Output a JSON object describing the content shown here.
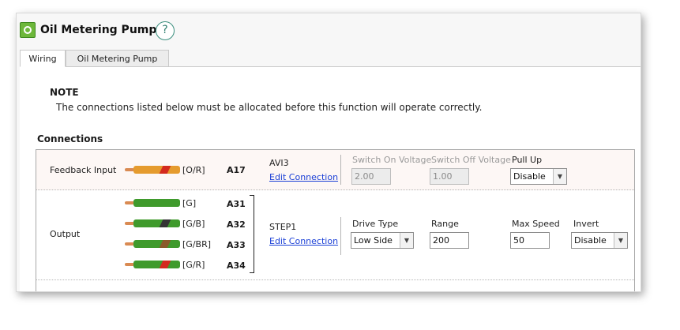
{
  "window": {
    "title": "Oil Metering Pump",
    "app_icon": "green-pump-icon",
    "help_icon": "question-mark-icon"
  },
  "tabs": [
    {
      "label": "Wiring",
      "active": true
    },
    {
      "label": "Oil Metering Pump",
      "active": false
    }
  ],
  "note": {
    "heading": "NOTE",
    "text": "The connections listed below must be allocated before this function will operate correctly."
  },
  "connections": {
    "heading": "Connections",
    "feedback": {
      "label": "Feedback Input",
      "wire": {
        "color_code": "[O/R]",
        "pin": "A17",
        "base_color": "#e59b2e",
        "stripe_color": "#d42a1e"
      },
      "channel": "AVI3",
      "edit_link": "Edit Connection",
      "switch_on_label": "Switch On Voltage",
      "switch_on_value": "2.00",
      "switch_off_label": "Switch Off Voltage",
      "switch_off_value": "1.00",
      "pull_up_label": "Pull Up",
      "pull_up_value": "Disable"
    },
    "output": {
      "label": "Output",
      "wires": [
        {
          "color_code": "[G]",
          "pin": "A31",
          "base_color": "#3f9a2c",
          "stripe_color": ""
        },
        {
          "color_code": "[G/B]",
          "pin": "A32",
          "base_color": "#3f9a2c",
          "stripe_color": "#333333"
        },
        {
          "color_code": "[G/BR]",
          "pin": "A33",
          "base_color": "#3f9a2c",
          "stripe_color": "#8a5a2b"
        },
        {
          "color_code": "[G/R]",
          "pin": "A34",
          "base_color": "#3f9a2c",
          "stripe_color": "#d42a1e"
        }
      ],
      "channel": "STEP1",
      "edit_link": "Edit Connection",
      "drive_type_label": "Drive Type",
      "drive_type_value": "Low Side",
      "range_label": "Range",
      "range_value": "200",
      "max_speed_label": "Max Speed",
      "max_speed_value": "50",
      "invert_label": "Invert",
      "invert_value": "Disable"
    }
  },
  "colors": {
    "link": "#1a3fd6",
    "help_icon": "#3a8e7d",
    "feedback_row_bg": "#fdf7f5"
  }
}
